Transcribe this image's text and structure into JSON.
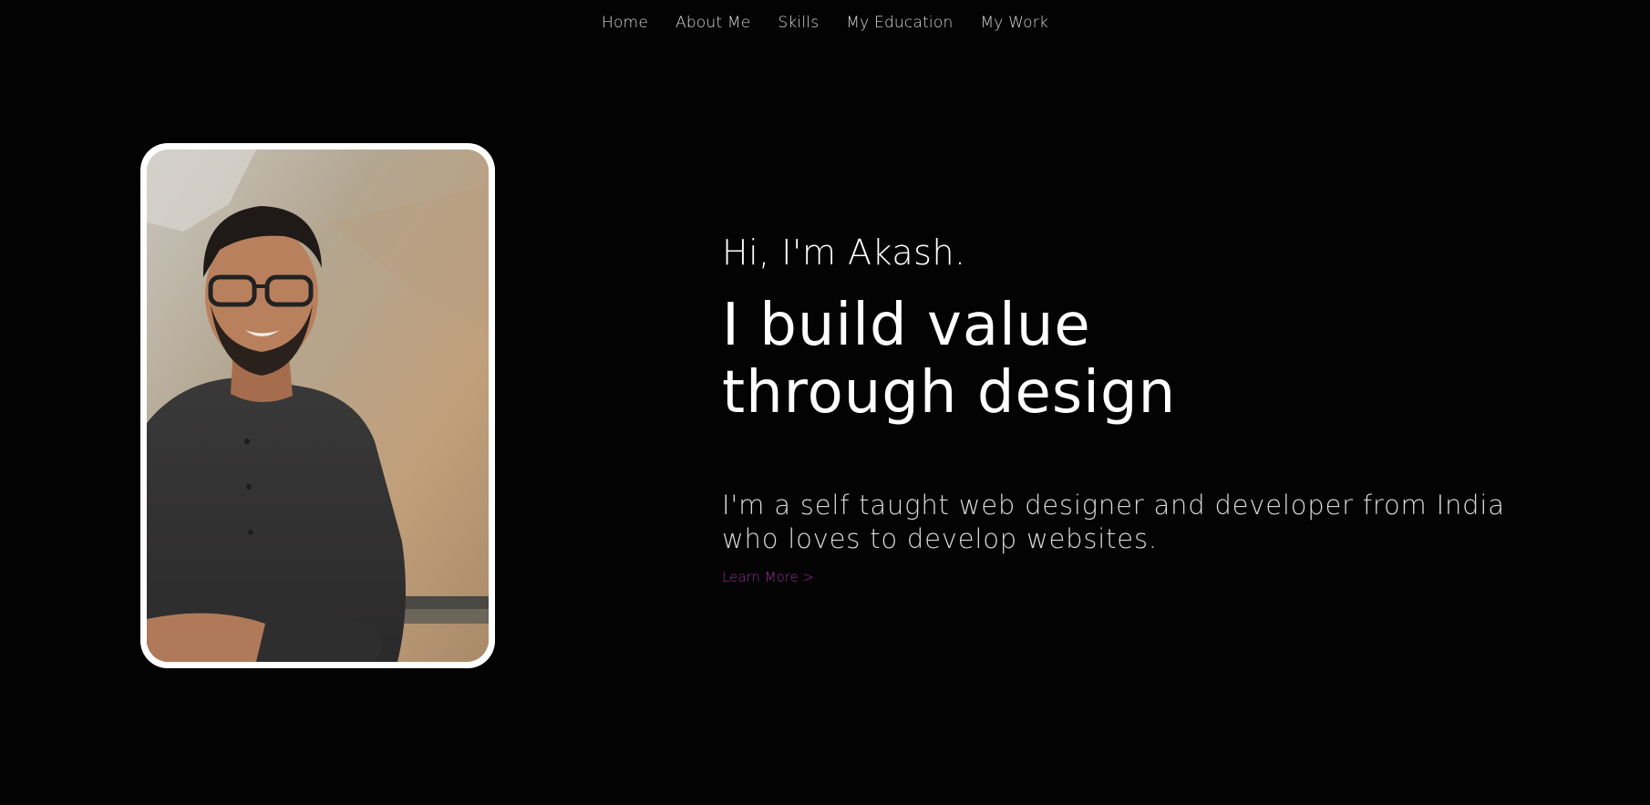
{
  "nav": {
    "items": [
      {
        "label": "Home"
      },
      {
        "label": "About Me"
      },
      {
        "label": "Skills"
      },
      {
        "label": "My Education"
      },
      {
        "label": "My Work"
      }
    ]
  },
  "hero": {
    "greeting": "Hi, I'm Akash.",
    "headline": "I build value through design",
    "intro": "I'm a self taught web designer and developer from India who loves to develop websites.",
    "learn_more": "Learn More >"
  },
  "colors": {
    "background": "#030303",
    "text": "#ffffff",
    "accent": "#9a2e9b"
  }
}
